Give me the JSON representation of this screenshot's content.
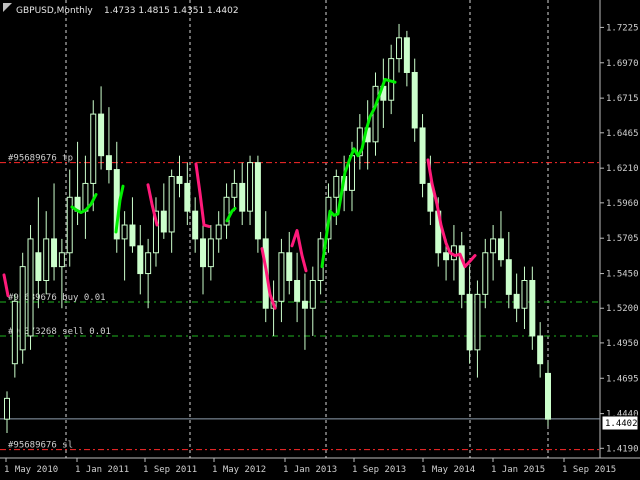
{
  "header": {
    "symbol_timeframe": "GBPUSD,Monthly",
    "ohlc": "1.4733 1.4815 1.4351 1.4402",
    "icon": "chart-corner-triangle-icon"
  },
  "current_price": "1.4402",
  "colors": {
    "background": "#000000",
    "candle": "#ccffcc",
    "wick": "#ccffcc",
    "up_line": "#00ee00",
    "down_line": "#ff1a7a",
    "tp_line": "#ff2a2a",
    "order_line": "#1fb31f",
    "grid": "#ffffff",
    "text": "#d0d0d0"
  },
  "orders": [
    {
      "label": "#95689676 tp",
      "price": 1.625,
      "type": "tp"
    },
    {
      "label": "#95689676 buy 0.01",
      "price": 1.5245,
      "type": "order"
    },
    {
      "label": "#96373268 sell 0.01",
      "price": 1.5,
      "type": "order"
    },
    {
      "label": "#95689676 sl",
      "price": 1.418,
      "type": "sl"
    }
  ],
  "chart_data": {
    "type": "candlestick",
    "symbol": "GBPUSD",
    "timeframe": "Monthly",
    "ylim": [
      1.412,
      1.7365
    ],
    "y_ticks": [
      "1.7225",
      "1.6970",
      "1.6715",
      "1.6465",
      "1.6210",
      "1.5960",
      "1.5705",
      "1.5450",
      "1.5200",
      "1.4950",
      "1.4695",
      "1.4440",
      "1.4190"
    ],
    "x_ticks": [
      "1 May 2010",
      "1 Jan 2011",
      "1 Sep 2011",
      "1 May 2012",
      "1 Jan 2013",
      "1 Sep 2013",
      "1 May 2014",
      "1 Jan 2015",
      "1 Sep 2015"
    ],
    "candles": [
      {
        "o": 1.44,
        "h": 1.46,
        "l": 1.43,
        "c": 1.455
      },
      {
        "o": 1.48,
        "h": 1.53,
        "l": 1.47,
        "c": 1.525
      },
      {
        "o": 1.49,
        "h": 1.56,
        "l": 1.48,
        "c": 1.55
      },
      {
        "o": 1.5,
        "h": 1.58,
        "l": 1.49,
        "c": 1.57
      },
      {
        "o": 1.56,
        "h": 1.6,
        "l": 1.52,
        "c": 1.54
      },
      {
        "o": 1.54,
        "h": 1.59,
        "l": 1.53,
        "c": 1.57
      },
      {
        "o": 1.57,
        "h": 1.61,
        "l": 1.54,
        "c": 1.55
      },
      {
        "o": 1.55,
        "h": 1.57,
        "l": 1.52,
        "c": 1.56
      },
      {
        "o": 1.56,
        "h": 1.62,
        "l": 1.55,
        "c": 1.6
      },
      {
        "o": 1.6,
        "h": 1.64,
        "l": 1.58,
        "c": 1.59
      },
      {
        "o": 1.59,
        "h": 1.63,
        "l": 1.57,
        "c": 1.61
      },
      {
        "o": 1.61,
        "h": 1.67,
        "l": 1.59,
        "c": 1.66
      },
      {
        "o": 1.66,
        "h": 1.68,
        "l": 1.62,
        "c": 1.63
      },
      {
        "o": 1.63,
        "h": 1.665,
        "l": 1.61,
        "c": 1.62
      },
      {
        "o": 1.62,
        "h": 1.64,
        "l": 1.56,
        "c": 1.57
      },
      {
        "o": 1.57,
        "h": 1.59,
        "l": 1.54,
        "c": 1.58
      },
      {
        "o": 1.58,
        "h": 1.6,
        "l": 1.56,
        "c": 1.565
      },
      {
        "o": 1.565,
        "h": 1.58,
        "l": 1.53,
        "c": 1.545
      },
      {
        "o": 1.545,
        "h": 1.57,
        "l": 1.52,
        "c": 1.56
      },
      {
        "o": 1.56,
        "h": 1.6,
        "l": 1.55,
        "c": 1.59
      },
      {
        "o": 1.59,
        "h": 1.61,
        "l": 1.57,
        "c": 1.575
      },
      {
        "o": 1.575,
        "h": 1.62,
        "l": 1.56,
        "c": 1.615
      },
      {
        "o": 1.615,
        "h": 1.63,
        "l": 1.6,
        "c": 1.61
      },
      {
        "o": 1.61,
        "h": 1.625,
        "l": 1.58,
        "c": 1.59
      },
      {
        "o": 1.59,
        "h": 1.6,
        "l": 1.56,
        "c": 1.57
      },
      {
        "o": 1.57,
        "h": 1.59,
        "l": 1.53,
        "c": 1.55
      },
      {
        "o": 1.55,
        "h": 1.58,
        "l": 1.54,
        "c": 1.57
      },
      {
        "o": 1.57,
        "h": 1.59,
        "l": 1.56,
        "c": 1.58
      },
      {
        "o": 1.58,
        "h": 1.61,
        "l": 1.57,
        "c": 1.6
      },
      {
        "o": 1.6,
        "h": 1.62,
        "l": 1.59,
        "c": 1.61
      },
      {
        "o": 1.61,
        "h": 1.625,
        "l": 1.58,
        "c": 1.59
      },
      {
        "o": 1.59,
        "h": 1.63,
        "l": 1.58,
        "c": 1.625
      },
      {
        "o": 1.625,
        "h": 1.63,
        "l": 1.56,
        "c": 1.57
      },
      {
        "o": 1.57,
        "h": 1.59,
        "l": 1.51,
        "c": 1.52
      },
      {
        "o": 1.52,
        "h": 1.54,
        "l": 1.5,
        "c": 1.525
      },
      {
        "o": 1.525,
        "h": 1.57,
        "l": 1.51,
        "c": 1.56
      },
      {
        "o": 1.56,
        "h": 1.575,
        "l": 1.53,
        "c": 1.54
      },
      {
        "o": 1.54,
        "h": 1.56,
        "l": 1.51,
        "c": 1.525
      },
      {
        "o": 1.525,
        "h": 1.545,
        "l": 1.49,
        "c": 1.52
      },
      {
        "o": 1.52,
        "h": 1.55,
        "l": 1.5,
        "c": 1.54
      },
      {
        "o": 1.54,
        "h": 1.575,
        "l": 1.53,
        "c": 1.57
      },
      {
        "o": 1.57,
        "h": 1.61,
        "l": 1.56,
        "c": 1.6
      },
      {
        "o": 1.6,
        "h": 1.62,
        "l": 1.58,
        "c": 1.615
      },
      {
        "o": 1.615,
        "h": 1.63,
        "l": 1.59,
        "c": 1.605
      },
      {
        "o": 1.605,
        "h": 1.64,
        "l": 1.59,
        "c": 1.63
      },
      {
        "o": 1.63,
        "h": 1.66,
        "l": 1.62,
        "c": 1.65
      },
      {
        "o": 1.65,
        "h": 1.67,
        "l": 1.62,
        "c": 1.64
      },
      {
        "o": 1.64,
        "h": 1.69,
        "l": 1.63,
        "c": 1.68
      },
      {
        "o": 1.68,
        "h": 1.7,
        "l": 1.65,
        "c": 1.67
      },
      {
        "o": 1.67,
        "h": 1.71,
        "l": 1.66,
        "c": 1.7
      },
      {
        "o": 1.7,
        "h": 1.725,
        "l": 1.69,
        "c": 1.715
      },
      {
        "o": 1.715,
        "h": 1.72,
        "l": 1.68,
        "c": 1.69
      },
      {
        "o": 1.69,
        "h": 1.7,
        "l": 1.64,
        "c": 1.65
      },
      {
        "o": 1.65,
        "h": 1.66,
        "l": 1.6,
        "c": 1.61
      },
      {
        "o": 1.61,
        "h": 1.63,
        "l": 1.58,
        "c": 1.59
      },
      {
        "o": 1.59,
        "h": 1.6,
        "l": 1.55,
        "c": 1.56
      },
      {
        "o": 1.56,
        "h": 1.57,
        "l": 1.54,
        "c": 1.555
      },
      {
        "o": 1.555,
        "h": 1.58,
        "l": 1.54,
        "c": 1.565
      },
      {
        "o": 1.565,
        "h": 1.575,
        "l": 1.52,
        "c": 1.53
      },
      {
        "o": 1.53,
        "h": 1.55,
        "l": 1.48,
        "c": 1.49
      },
      {
        "o": 1.49,
        "h": 1.54,
        "l": 1.47,
        "c": 1.53
      },
      {
        "o": 1.53,
        "h": 1.57,
        "l": 1.52,
        "c": 1.56
      },
      {
        "o": 1.56,
        "h": 1.58,
        "l": 1.54,
        "c": 1.57
      },
      {
        "o": 1.57,
        "h": 1.59,
        "l": 1.55,
        "c": 1.555
      },
      {
        "o": 1.555,
        "h": 1.575,
        "l": 1.52,
        "c": 1.53
      },
      {
        "o": 1.53,
        "h": 1.545,
        "l": 1.51,
        "c": 1.52
      },
      {
        "o": 1.52,
        "h": 1.55,
        "l": 1.505,
        "c": 1.54
      },
      {
        "o": 1.54,
        "h": 1.55,
        "l": 1.49,
        "c": 1.5
      },
      {
        "o": 1.5,
        "h": 1.51,
        "l": 1.47,
        "c": 1.48
      },
      {
        "o": 1.473,
        "h": 1.481,
        "l": 1.435,
        "c": 1.44
      }
    ],
    "up_line": [
      [
        [
          72,
          1.593
        ],
        [
          76,
          1.591
        ],
        [
          81,
          1.589
        ],
        [
          86,
          1.591
        ],
        [
          91,
          1.595
        ],
        [
          96,
          1.602
        ]
      ],
      [
        [
          116,
          1.575
        ],
        [
          120,
          1.598
        ],
        [
          123,
          1.608
        ]
      ],
      [
        [
          227,
          1.583
        ],
        [
          232,
          1.59
        ],
        [
          235,
          1.592
        ]
      ],
      [
        [
          322,
          1.55
        ],
        [
          326,
          1.57
        ],
        [
          330,
          1.59
        ],
        [
          334,
          1.587
        ],
        [
          338,
          1.588
        ],
        [
          342,
          1.605
        ],
        [
          345,
          1.618
        ],
        [
          350,
          1.628
        ],
        [
          354,
          1.635
        ],
        [
          358,
          1.63
        ],
        [
          362,
          1.635
        ],
        [
          366,
          1.648
        ],
        [
          370,
          1.658
        ],
        [
          375,
          1.665
        ],
        [
          380,
          1.675
        ],
        [
          385,
          1.685
        ],
        [
          390,
          1.684
        ],
        [
          395,
          1.683
        ]
      ]
    ],
    "down_line": [
      [
        [
          4,
          1.544
        ],
        [
          8,
          1.529
        ]
      ],
      [
        [
          148,
          1.609
        ],
        [
          152,
          1.595
        ],
        [
          157,
          1.58
        ]
      ],
      [
        [
          196,
          1.624
        ],
        [
          200,
          1.603
        ],
        [
          204,
          1.58
        ],
        [
          209,
          1.579
        ]
      ],
      [
        [
          262,
          1.563
        ],
        [
          266,
          1.548
        ],
        [
          270,
          1.53
        ],
        [
          275,
          1.52
        ]
      ],
      [
        [
          292,
          1.565
        ],
        [
          297,
          1.576
        ],
        [
          302,
          1.558
        ],
        [
          306,
          1.547
        ]
      ],
      [
        [
          428,
          1.627
        ],
        [
          432,
          1.61
        ],
        [
          437,
          1.595
        ],
        [
          441,
          1.58
        ],
        [
          446,
          1.567
        ],
        [
          450,
          1.56
        ],
        [
          455,
          1.558
        ],
        [
          460,
          1.559
        ],
        [
          465,
          1.55
        ],
        [
          470,
          1.554
        ],
        [
          475,
          1.558
        ]
      ]
    ]
  }
}
